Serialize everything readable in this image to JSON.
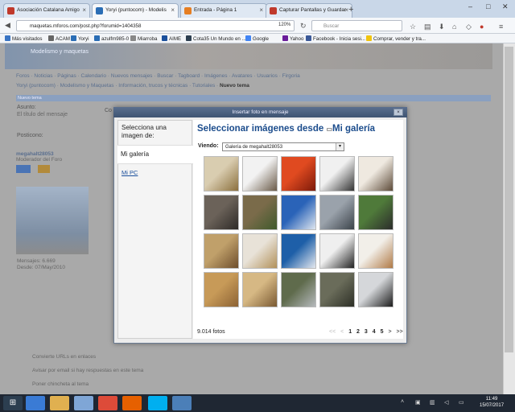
{
  "tabs": [
    {
      "title": "Asociación Catalana Amigo",
      "color": "#c0392b",
      "active": false
    },
    {
      "title": "Yoryi (puntocom) - Modelis",
      "color": "#2a6db5",
      "active": true
    },
    {
      "title": "Entrada - Página 1",
      "color": "#e67e22",
      "active": false
    },
    {
      "title": "Capturar Pantallas y Guardar",
      "color": "#c0392b",
      "active": false
    }
  ],
  "url": "maquetas.mforos.com/post.php?forumid=1404358",
  "zoom": "120%",
  "search_placeholder": "Buscar",
  "bookmarks": [
    {
      "label": "Más visitados",
      "color": "#3a75c4"
    },
    {
      "label": "ACAM",
      "color": "#666"
    },
    {
      "label": "Yoryi",
      "color": "#2a6db5"
    },
    {
      "label": "azulfm985-0",
      "color": "#2a6db5"
    },
    {
      "label": "Miarroba",
      "color": "#888"
    },
    {
      "label": "AIME",
      "color": "#1a4f9c"
    },
    {
      "label": "Cota35 Un Mundo en ...",
      "color": "#2c3e50"
    },
    {
      "label": "Google",
      "color": "#4285f4"
    },
    {
      "label": "Yahoo",
      "color": "#6a1b9a"
    },
    {
      "label": "Facebook - Inicia sesi...",
      "color": "#3b5998"
    },
    {
      "label": "Comprar, vender y tra...",
      "color": "#f1c40f"
    }
  ],
  "site": {
    "banner_title": "Modelismo y maquetas",
    "menu": "Foros · Noticias · Páginas · Calendario · Nuevos mensajes · Buscar · Tagboard · Imágenes · Avatares · Usuarios · Firgoria",
    "crumb": "Yoryi (puntocom) · Modelismo y Maquetas · Información, trucos y técnicas · Tutoriales · ",
    "crumb_current": "Nuevo tema",
    "formbar": "Nuevo tema",
    "asunto_label": "Asunto:",
    "asunto_hint": "El título del mensaje",
    "posticono_label": "Posticono:",
    "user_name": "megahalt28053",
    "user_role": "Moderador del Foro",
    "mensajes": "Mensajes: 6.669",
    "desde": "Desde: 07/May/2010",
    "opt1": "Convierte URLs en enlaces",
    "opt2": "Avisar por email si hay respuestas en este tema",
    "opt3": "Poner chincheta al tema",
    "co_label": "Co"
  },
  "modal": {
    "title": "Insertar foto en mensaje",
    "close": "×",
    "left_title": "Selecciona una imagen de:",
    "mi_galeria": "Mi galería",
    "mi_pc": "Mi PC",
    "heading": "Seleccionar imágenes desde ",
    "heading_source": "Mi galería",
    "viendo_label": "Viendo:",
    "select_value": "Galería de megahalt28053",
    "count": "9.014 fotos",
    "pager": {
      "first": "<<",
      "prev": "<",
      "pages": [
        "1",
        "2",
        "3",
        "4",
        "5"
      ],
      "next": ">",
      "last": ">>"
    }
  },
  "thumbs": [
    {
      "a": "#d9cdb0",
      "b": "#8b6f3d"
    },
    {
      "a": "#f2f2f2",
      "b": "#6a5a48"
    },
    {
      "a": "#e04a20",
      "b": "#7d1a0a"
    },
    {
      "a": "#f0f0f0",
      "b": "#333333"
    },
    {
      "a": "#efe9e0",
      "b": "#5c4a38"
    },
    {
      "a": "#6b6259",
      "b": "#2e2a27"
    },
    {
      "a": "#7a6b4a",
      "b": "#3f5a2c"
    },
    {
      "a": "#2a63b8",
      "b": "#dfe6ef"
    },
    {
      "a": "#9aa2ab",
      "b": "#3c434a"
    },
    {
      "a": "#4f7a3a",
      "b": "#2c2c2c"
    },
    {
      "a": "#c0a06a",
      "b": "#6e4e2c"
    },
    {
      "a": "#e8e2d8",
      "b": "#b2915a"
    },
    {
      "a": "#1e5fa8",
      "b": "#e5e9ef"
    },
    {
      "a": "#efefef",
      "b": "#222222"
    },
    {
      "a": "#f2efe9",
      "b": "#b07a46"
    },
    {
      "a": "#c79a58",
      "b": "#8c6234"
    },
    {
      "a": "#d6b884",
      "b": "#7a5a32"
    },
    {
      "a": "#5f6b4c",
      "b": "#b5b9bc"
    },
    {
      "a": "#6a6c5a",
      "b": "#2d2f26"
    },
    {
      "a": "#d5d7da",
      "b": "#1c1c1c"
    }
  ],
  "taskbar": {
    "time": "11:49",
    "date": "15/07/2017"
  }
}
